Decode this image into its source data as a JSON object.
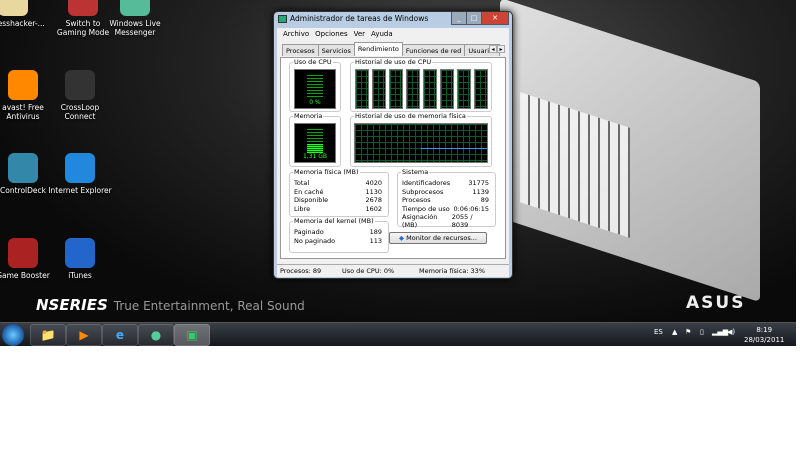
{
  "desktop": {
    "icons": [
      {
        "label": "processhacker-...",
        "color": "#e8d8a0"
      },
      {
        "label": "Switch to Gaming Mode",
        "color": "#b33"
      },
      {
        "label": "Windows Live Messenger",
        "color": "#5b9"
      },
      {
        "label": "avast! Free Antivirus",
        "color": "#f80"
      },
      {
        "label": "CrossLoop Connect",
        "color": "#333"
      },
      {
        "label": "ControlDeck",
        "color": "#38a"
      },
      {
        "label": "Internet Explorer",
        "color": "#28d"
      },
      {
        "label": "Game Booster",
        "color": "#a22"
      },
      {
        "label": "iTunes",
        "color": "#26c"
      }
    ],
    "brand_series": "NSERIES",
    "brand_tagline": "True Entertainment, Real Sound",
    "brand_logo": "ASUS"
  },
  "taskbar": {
    "language": "ES",
    "time": "8:19",
    "date": "28/03/2011"
  },
  "window": {
    "title": "Administrador de tareas de Windows",
    "menu": [
      "Archivo",
      "Opciones",
      "Ver",
      "Ayuda"
    ],
    "tabs": [
      "Procesos",
      "Servicios",
      "Rendimiento",
      "Funciones de red",
      "Usuarios"
    ],
    "active_tab": "Rendimiento",
    "cpu_label": "Uso de CPU",
    "cpu_value": "0 %",
    "cpu_history_label": "Historial de uso de CPU",
    "cpu_cores": 8,
    "mem_label": "Memoria",
    "mem_value": "1,31 GB",
    "mem_history_label": "Historial de uso de memoria física",
    "physical": {
      "label": "Memoria física (MB)",
      "rows": [
        [
          "Total",
          "4020"
        ],
        [
          "En caché",
          "1130"
        ],
        [
          "Disponible",
          "2678"
        ],
        [
          "Libre",
          "1602"
        ]
      ]
    },
    "kernel": {
      "label": "Memoria del kernel (MB)",
      "rows": [
        [
          "Paginado",
          "189"
        ],
        [
          "No paginado",
          "113"
        ]
      ]
    },
    "system": {
      "label": "Sistema",
      "rows": [
        [
          "Identificadores",
          "31775"
        ],
        [
          "Subprocesos",
          "1139"
        ],
        [
          "Procesos",
          "89"
        ],
        [
          "Tiempo de uso",
          "0:06:06:15"
        ],
        [
          "Asignación (MB)",
          "2055 / 8039"
        ]
      ]
    },
    "resource_button": "Monitor de recursos...",
    "status": {
      "processes": "Procesos: 89",
      "cpu": "Uso de CPU: 0%",
      "memory": "Memoria física: 33%"
    }
  }
}
